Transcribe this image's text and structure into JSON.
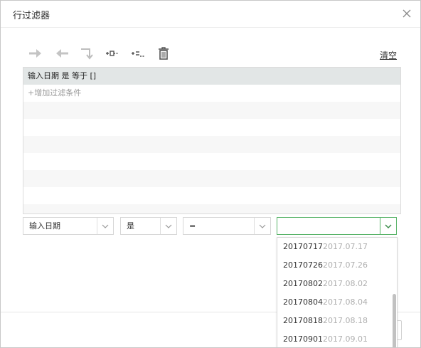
{
  "dialog": {
    "title": "行过滤器"
  },
  "toolbar": {
    "clear_label": "清空",
    "icons": [
      "arrow-right-icon",
      "arrow-left-icon",
      "return-arrow-icon",
      "indent-icon",
      "outdent-icon",
      "trash-icon"
    ]
  },
  "filter_list": {
    "condition": "输入日期 是 等于 []",
    "add_label": "+增加过滤条件"
  },
  "condition_editor": {
    "field_value": "输入日期",
    "negation_value": "是",
    "operator_value": "=",
    "value_input": ""
  },
  "dropdown": {
    "options": [
      {
        "code": "20170717",
        "date": "2017.07.17"
      },
      {
        "code": "20170726",
        "date": "2017.07.26"
      },
      {
        "code": "20170802",
        "date": "2017.08.02"
      },
      {
        "code": "20170804",
        "date": "2017.08.04"
      },
      {
        "code": "20170818",
        "date": "2017.08.18"
      },
      {
        "code": "20170901",
        "date": "2017.09.01"
      }
    ]
  },
  "colors": {
    "accent": "#58b368",
    "active_row": "#e2e6e6",
    "muted_text": "#b0b0b0"
  }
}
